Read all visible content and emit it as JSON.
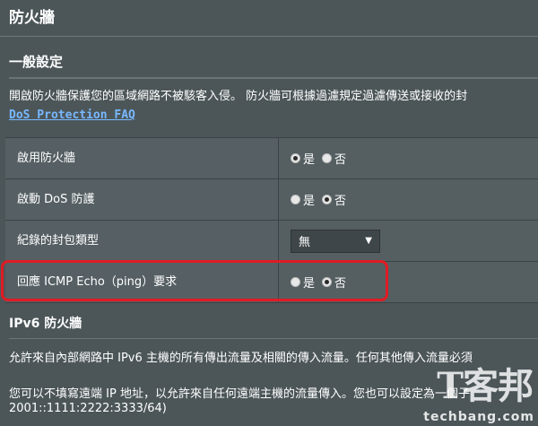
{
  "page": {
    "title": "防火牆"
  },
  "general": {
    "title": "一般設定",
    "description": "開啟防火牆保護您的區域網路不被駭客入侵。 防火牆可根據過濾規定過濾傳送或接收的封",
    "faq_link": "DoS Protection FAQ"
  },
  "settings": {
    "rows": [
      {
        "label": "啟用防火牆",
        "type": "radio",
        "options": [
          "是",
          "否"
        ],
        "selected": "是"
      },
      {
        "label": "啟動 DoS 防護",
        "type": "radio",
        "options": [
          "是",
          "否"
        ],
        "selected": "否"
      },
      {
        "label": "紀錄的封包類型",
        "type": "select",
        "value": "無"
      },
      {
        "label": "回應 ICMP Echo（ping）要求",
        "type": "radio",
        "options": [
          "是",
          "否"
        ],
        "selected": "否"
      }
    ]
  },
  "ipv6": {
    "title": "IPv6 防火牆",
    "desc1": "允許來自內部網路中 IPv6 主機的所有傳出流量及相關的傳入流量。任何其他傳入流量必須",
    "desc2": "您可以不填寫遠端 IP 地址，以允許來自任何遠端主機的流量傳入。您也可以設定為一個子",
    "desc3": "2001::1111:2222:3333/64)"
  },
  "colors": {
    "background": "#4c5659",
    "link": "#78b8ff",
    "highlight": "#e01b23"
  },
  "icons": {
    "dropdown": "caret-down-icon"
  },
  "watermark": {
    "cjk": "T客邦",
    "latin": "techbang.com"
  }
}
